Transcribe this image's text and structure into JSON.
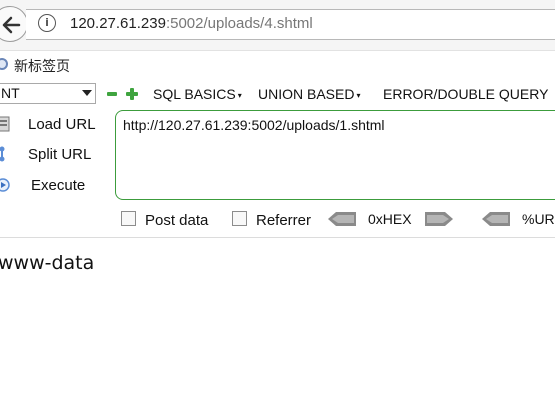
{
  "address_bar": {
    "url_host": "120.27.61.239",
    "url_rest": ":5002/uploads/4.shtml"
  },
  "bookmarks": {
    "new_tab_label": "新标签页"
  },
  "hackbar": {
    "select_value": "NT",
    "menus": {
      "sql_basics": "SQL BASICS",
      "union_based": "UNION BASED",
      "error_double_query": "ERROR/DOUBLE QUERY"
    },
    "actions": {
      "load_url": "Load URL",
      "split_url": "Split URL",
      "execute": "Execute"
    },
    "textarea_value": "http://120.27.61.239:5002/uploads/1.shtml",
    "options": {
      "post_data": "Post data",
      "referrer": "Referrer",
      "hex": "0xHEX",
      "url_encode": "%URL"
    }
  },
  "page_output": "www-data",
  "colors": {
    "accent_green": "#3fa43f",
    "textarea_border": "#3c9c3c"
  }
}
